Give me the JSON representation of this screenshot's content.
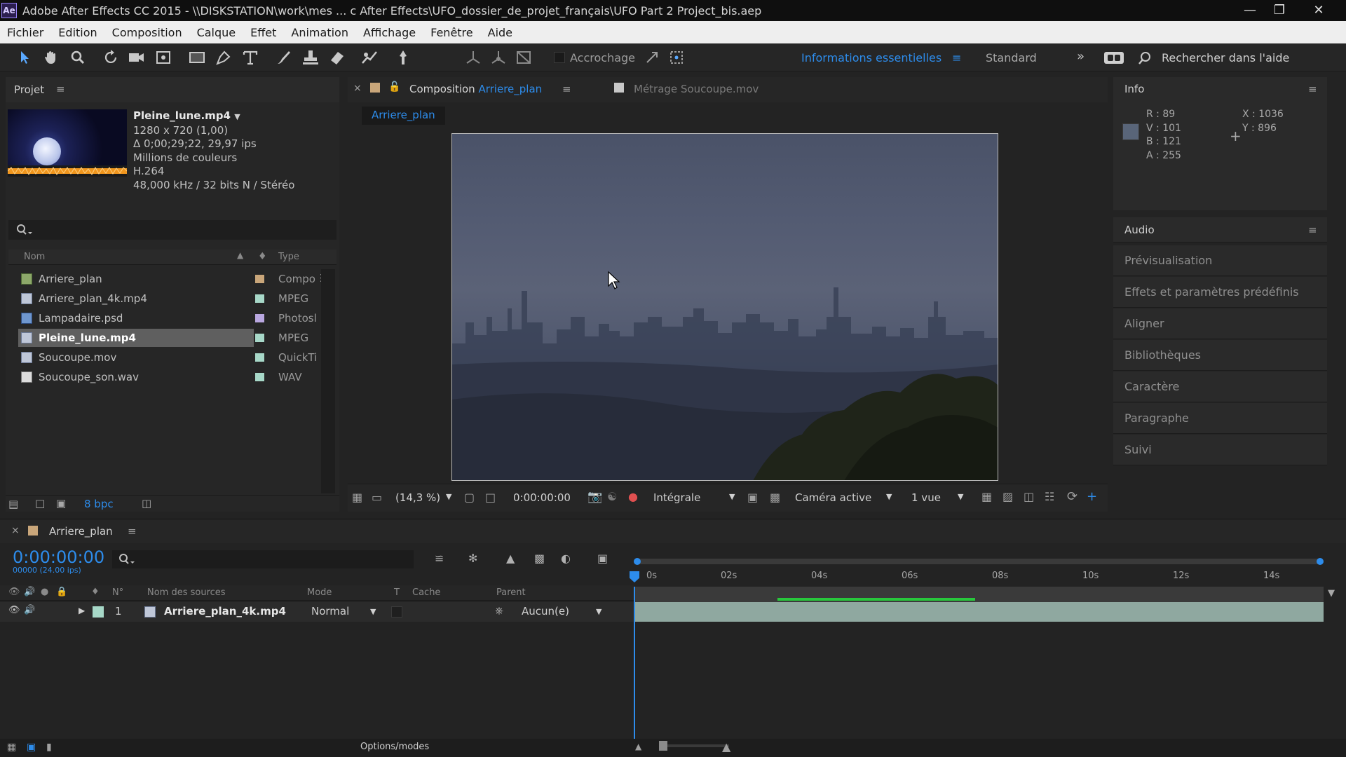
{
  "window": {
    "title": "Adobe After Effects CC 2015 - \\\\DISKSTATION\\work\\mes ... c After Effects\\UFO_dossier_de_projet_français\\UFO Part 2 Project_bis.aep",
    "app_badge": "Ae"
  },
  "menu": [
    "Fichier",
    "Edition",
    "Composition",
    "Calque",
    "Effet",
    "Animation",
    "Affichage",
    "Fenêtre",
    "Aide"
  ],
  "toolbar": {
    "snapping_label": "Accrochage",
    "workspace_active": "Informations essentielles",
    "workspace_other": "Standard",
    "search_placeholder": "Rechercher dans l'aide"
  },
  "project": {
    "panel_title": "Projet",
    "selected_name": "Pleine_lune.mp4",
    "meta": [
      "1280 x 720 (1,00)",
      "Δ 0;00;29;22, 29,97 ips",
      "Millions de couleurs",
      "H.264",
      "48,000 kHz / 32 bits N / Stéréo"
    ],
    "col_name": "Nom",
    "col_type": "Type",
    "items": [
      {
        "name": "Arriere_plan",
        "type": "Compo",
        "label_color": "#c9a67a",
        "selected": false
      },
      {
        "name": "Arriere_plan_4k.mp4",
        "type": "MPEG",
        "label_color": "#a7d8c8",
        "selected": false
      },
      {
        "name": "Lampadaire.psd",
        "type": "Photosl",
        "label_color": "#b9a7e0",
        "selected": false
      },
      {
        "name": "Pleine_lune.mp4",
        "type": "MPEG",
        "label_color": "#a7d8c8",
        "selected": true
      },
      {
        "name": "Soucoupe.mov",
        "type": "QuickTi",
        "label_color": "#a7d8c8",
        "selected": false
      },
      {
        "name": "Soucoupe_son.wav",
        "type": "WAV",
        "label_color": "#a7d8c8",
        "selected": false
      }
    ],
    "bpc": "8 bpc"
  },
  "composition": {
    "tab_prefix": "Composition",
    "tab_name": "Arriere_plan",
    "footage_prefix": "Métrage",
    "footage_name": "Soucoupe.mov",
    "breadcrumb": "Arriere_plan",
    "zoom": "(14,3 %)",
    "timecode": "0:00:00:00",
    "resolution": "Intégrale",
    "camera": "Caméra active",
    "views": "1 vue"
  },
  "info": {
    "title": "Info",
    "r": "R : 89",
    "v": "V : 101",
    "b": "B : 121",
    "a": "A : 255",
    "x": "X : 1036",
    "y": "Y : 896",
    "swatch_color": "#596579"
  },
  "right_panels": {
    "audio_title": "Audio",
    "items": [
      "Prévisualisation",
      "Effets et paramètres prédéfinis",
      "Aligner",
      "Bibliothèques",
      "Caractère",
      "Paragraphe",
      "Suivi"
    ]
  },
  "timeline": {
    "comp_name": "Arriere_plan",
    "timecode": "0:00:00:00",
    "frames": "00000 (24.00 ips)",
    "headers": {
      "num": "N°",
      "source": "Nom des sources",
      "mode": "Mode",
      "t": "T",
      "matte": "Cache",
      "parent": "Parent"
    },
    "ruler": [
      "0s",
      "02s",
      "04s",
      "06s",
      "08s",
      "10s",
      "12s",
      "14s"
    ],
    "layers": [
      {
        "num": "1",
        "name": "Arriere_plan_4k.mp4",
        "mode": "Normal",
        "parent": "Aucun(e)"
      }
    ],
    "status": "Options/modes"
  }
}
